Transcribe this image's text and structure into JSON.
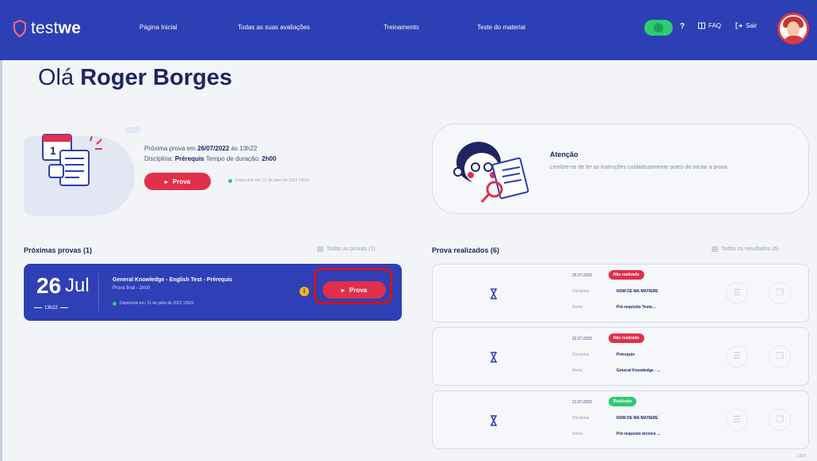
{
  "brand": {
    "name_prefix": "test",
    "name_bold": "we"
  },
  "nav": [
    {
      "label": "Página Inicial"
    },
    {
      "label": "Todas as suas avaliações"
    },
    {
      "label": "Treinamento"
    },
    {
      "label": "Teste do material"
    }
  ],
  "tools": {
    "help": "?",
    "faq": "FAQ",
    "logout": "Sair"
  },
  "greeting": {
    "prefix": "Olá",
    "name": "Roger Borges"
  },
  "next_exam": {
    "line1_prefix": "Próxima prova em",
    "date": "26/07/2022",
    "at": "às",
    "time": "13h22",
    "line2_discipline_label": "Disciplina:",
    "discipline": "Prérequis",
    "duration_label": "Tempo de duração:",
    "duration": "2h00",
    "button": "Prova",
    "availability": "Disponível em: 21 de julho de 2022 13h22"
  },
  "attention": {
    "title": "Atenção",
    "text": "Lembre-se de ler as instruções cuidadosamente antes de iniciar a prova"
  },
  "upcoming": {
    "title": "Próximas provas (1)",
    "link": "Todas as provas (1)",
    "exam": {
      "day": "26",
      "month": "Jul",
      "time": "13h22",
      "title": "General Knowledge - English Test - Prérequis",
      "duration": "Prova final - 2h00",
      "availability": "Disponível em: 21 de julho de 2022 13h22",
      "info": "i",
      "button": "Prova"
    }
  },
  "results": {
    "title": "Prova realizados (6)",
    "link": "Todos os resultados (6)",
    "items": [
      {
        "date": "25.07.2022",
        "badge": "Não realizado",
        "badge_color": "#e0304a",
        "k1": "Disciplina",
        "v1": "NOM DE MA MATIERE",
        "k2": "Nome",
        "v2": "Pré-requisito Teste..."
      },
      {
        "date": "22.07.2022",
        "badge": "Não realizado",
        "badge_color": "#e0304a",
        "k1": "Disciplina",
        "v1": "Prérequis",
        "k2": "Nome",
        "v2": "General Knowledge - ..."
      },
      {
        "date": "21.07.2022",
        "badge": "Realizado",
        "badge_color": "#2ecb72",
        "k1": "Disciplina",
        "v1": "NOM DE MA MATIERE",
        "k2": "Nome",
        "v2": "Pré-requisito técnico ..."
      }
    ]
  },
  "version": "2.8.8",
  "colors": {
    "primary": "#2d3fb4",
    "accent": "#e0304a",
    "success": "#2ecb72",
    "warning": "#f4b21f"
  }
}
